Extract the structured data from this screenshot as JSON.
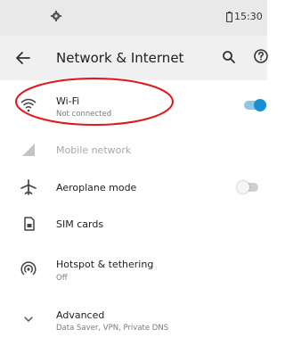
{
  "status": {
    "time": "15:30",
    "gear_icon": "gear-icon",
    "battery_icon": "battery-icon"
  },
  "toolbar": {
    "title": "Network & Internet",
    "back_icon": "arrow-left-icon",
    "search_icon": "search-icon",
    "help_icon": "help-icon"
  },
  "items": [
    {
      "title": "Wi-Fi",
      "subtitle": "Not connected",
      "icon": "wifi-icon",
      "toggle": true,
      "enabled": true
    },
    {
      "title": "Mobile network",
      "subtitle": "",
      "icon": "signal-icon",
      "enabled": false
    },
    {
      "title": "Aeroplane mode",
      "subtitle": "",
      "icon": "airplane-icon",
      "toggle": false,
      "enabled": true
    },
    {
      "title": "SIM cards",
      "subtitle": "",
      "icon": "sim-card-icon",
      "enabled": true
    },
    {
      "title": "Hotspot & tethering",
      "subtitle": "Off",
      "icon": "hotspot-icon",
      "enabled": true
    },
    {
      "title": "Advanced",
      "subtitle": "Data Saver, VPN, Private DNS",
      "icon": "chevron-down-icon",
      "enabled": true
    }
  ],
  "colors": {
    "accent": "#1a8fd0",
    "annotation": "#e01818"
  }
}
